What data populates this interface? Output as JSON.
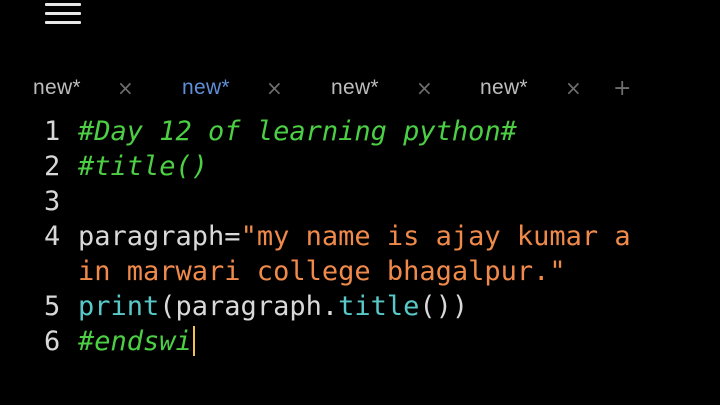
{
  "menu": {
    "icon": "hamburger-menu-icon"
  },
  "tabs": [
    {
      "label": "new*",
      "active": false,
      "close": "×"
    },
    {
      "label": "new*",
      "active": true,
      "close": "×"
    },
    {
      "label": "new*",
      "active": false,
      "close": "×"
    },
    {
      "label": "new*",
      "active": false,
      "close": "×"
    }
  ],
  "add_tab": "+",
  "editor": {
    "lines": [
      {
        "number": "1",
        "tokens": [
          {
            "t": "#Day 12 of learning python#",
            "k": "comment"
          }
        ]
      },
      {
        "number": "2",
        "tokens": [
          {
            "t": "#title()",
            "k": "comment"
          }
        ]
      },
      {
        "number": "3",
        "tokens": []
      },
      {
        "number": "4",
        "tokens": [
          {
            "t": "paragraph=",
            "k": "plain"
          },
          {
            "t": "\"my name is ajay kumar a",
            "k": "string"
          }
        ]
      },
      {
        "number": "",
        "tokens": [
          {
            "t": "in marwari college bhagalpur.\"",
            "k": "string"
          }
        ]
      },
      {
        "number": "5",
        "tokens": [
          {
            "t": "print",
            "k": "builtin"
          },
          {
            "t": "(paragraph.",
            "k": "plain"
          },
          {
            "t": "title",
            "k": "builtin"
          },
          {
            "t": "())",
            "k": "plain"
          }
        ]
      },
      {
        "number": "6",
        "tokens": [
          {
            "t": "#endswi",
            "k": "comment"
          }
        ],
        "cursor": true
      }
    ]
  },
  "colors": {
    "background": "#000000",
    "comment": "#4ccf45",
    "string": "#f08a4b",
    "builtin": "#58c8c8",
    "plain": "#d9d9d9",
    "active_tab": "#5f8fd8",
    "cursor": "#f2c14e"
  }
}
